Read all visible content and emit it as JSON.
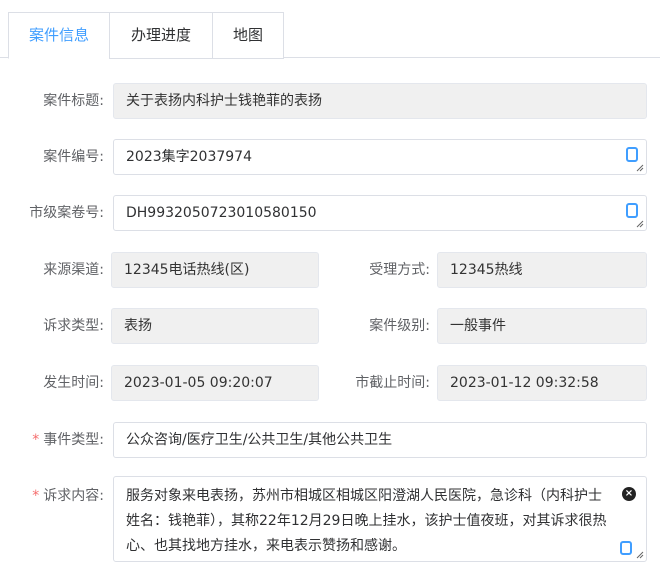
{
  "tabs": [
    {
      "label": "案件信息",
      "active": true
    },
    {
      "label": "办理进度",
      "active": false
    },
    {
      "label": "地图",
      "active": false
    }
  ],
  "form": {
    "title": {
      "label": "案件标题:",
      "value": "关于表扬内科护士钱艳菲的表扬"
    },
    "case_no": {
      "label": "案件编号:",
      "value": "2023集字2037974"
    },
    "city_no": {
      "label": "市级案卷号:",
      "value": "DH9932050723010580150"
    },
    "source": {
      "label": "来源渠道:",
      "value": "12345电话热线(区)"
    },
    "accept_method": {
      "label": "受理方式:",
      "value": "12345热线"
    },
    "appeal_type": {
      "label": "诉求类型:",
      "value": "表扬"
    },
    "case_level": {
      "label": "案件级别:",
      "value": "一般事件"
    },
    "occur_time": {
      "label": "发生时间:",
      "value": "2023-01-05 09:20:07"
    },
    "deadline": {
      "label": "市截止时间:",
      "value": "2023-01-12 09:32:58"
    },
    "event_type": {
      "label": "事件类型:",
      "value": "公众咨询/医疗卫生/公共卫生/其他公共卫生",
      "required": "*"
    },
    "appeal_content": {
      "label": "诉求内容:",
      "value": "服务对象来电表扬，苏州市相城区相城区阳澄湖人民医院，急诊科（内科护士姓名：钱艳菲），其称22年12月29日晚上挂水，该护士值夜班，对其诉求很热心、也其找地方挂水，来电表示赞扬和感谢。",
      "required": "*"
    }
  },
  "colors": {
    "accent": "#409eff",
    "required": "#f56c6c",
    "disabled_bg": "#f0f0f0"
  }
}
